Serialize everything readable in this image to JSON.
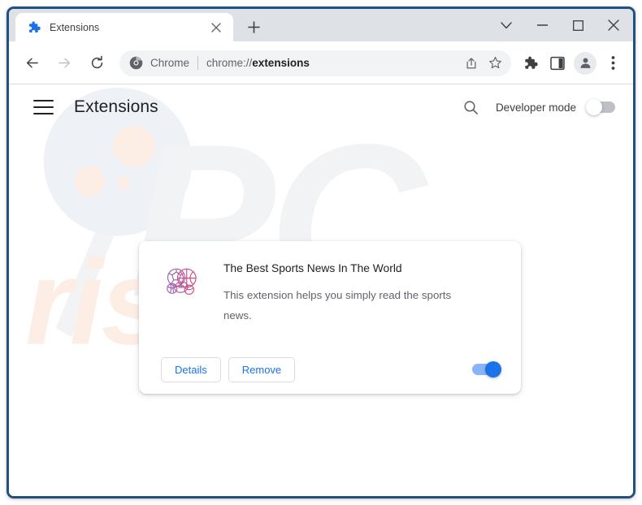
{
  "browser": {
    "tab": {
      "favicon": "puzzle-piece-icon",
      "title": "Extensions",
      "close_label": "×"
    },
    "new_tab_label": "+",
    "window_controls": {
      "chevron_label": "⌄",
      "minimize_label": "—",
      "maximize_label": "□",
      "close_label": "✕"
    },
    "nav": {
      "back": "back-arrow-icon",
      "forward": "forward-arrow-icon",
      "reload": "reload-icon"
    },
    "omnibox": {
      "site_icon": "chrome-logo-icon",
      "site_label": "Chrome",
      "separator": "|",
      "url_prefix": "chrome://",
      "url_strong": "extensions",
      "share_icon": "share-icon",
      "bookmark_icon": "star-icon"
    },
    "toolbar_icons": {
      "extensions": "puzzle-piece-icon",
      "side_panel": "side-panel-icon",
      "profile": "account-avatar-icon",
      "menu": "three-dot-menu-icon"
    }
  },
  "extensions_page": {
    "menu_button": "hamburger-menu-icon",
    "title": "Extensions",
    "search_icon": "search-icon",
    "developer_mode_label": "Developer mode",
    "developer_mode_on": false,
    "card": {
      "icon": "sports-balls-icon",
      "name": "The Best Sports News In The World",
      "description": "This extension helps you simply read the sports news.",
      "details_label": "Details",
      "remove_label": "Remove",
      "enabled": true
    }
  },
  "watermark": {
    "brand_pc": "PC",
    "brand_risk": "risk.com"
  },
  "colors": {
    "window_border": "#22517f",
    "tabstrip": "#dee1e6",
    "accent_blue": "#1a73e8",
    "toggle_on_track": "#8ab4f8",
    "toggle_off_track": "#bdc1c6",
    "text_primary": "#202124",
    "text_secondary": "#5f6368",
    "watermark_gray": "#f1f2f4",
    "watermark_orange": "#fdf0e8"
  }
}
